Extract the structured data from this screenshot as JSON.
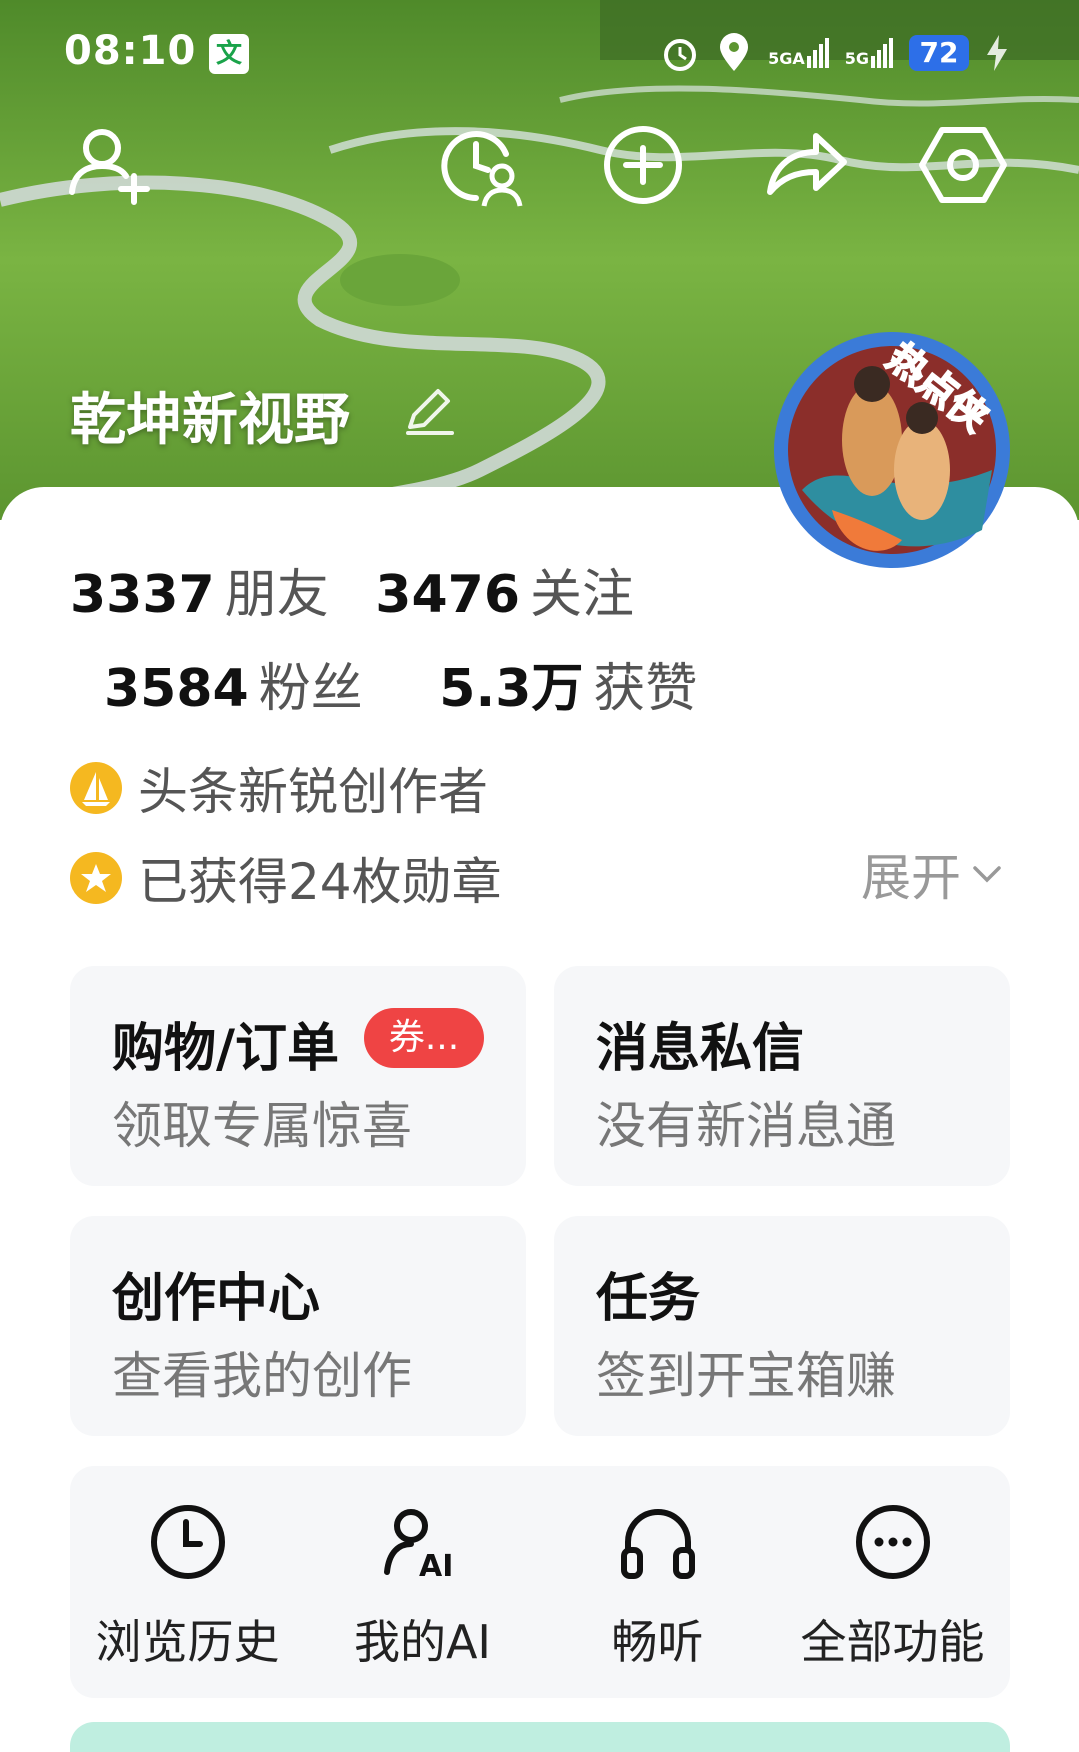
{
  "status_bar": {
    "time": "08:10",
    "app_badge": "文",
    "signal_1": "5GA",
    "signal_2": "5G",
    "battery": "72"
  },
  "profile": {
    "name": "乾坤新视野",
    "avatar_badge": "热点侠"
  },
  "stats": {
    "friends_value": "3337",
    "friends_label": "朋友",
    "following_value": "3476",
    "following_label": "关注",
    "fans_value": "3584",
    "fans_label": "粉丝",
    "likes_value": "5.3万",
    "likes_label": "获赞"
  },
  "meta": {
    "creator_level": "头条新锐创作者",
    "medals": "已获得24枚勋章",
    "expand_label": "展开"
  },
  "cards": [
    {
      "title": "购物/订单",
      "subtitle": "领取专属惊喜",
      "tag": "券..."
    },
    {
      "title": "消息私信",
      "subtitle": "没有新消息通"
    },
    {
      "title": "创作中心",
      "subtitle": "查看我的创作"
    },
    {
      "title": "任务",
      "subtitle": "签到开宝箱赚"
    }
  ],
  "quick_actions": [
    {
      "label": "浏览历史",
      "icon": "clock-icon"
    },
    {
      "label": "我的AI",
      "icon": "ai-person-icon"
    },
    {
      "label": "畅听",
      "icon": "headphones-icon"
    },
    {
      "label": "全部功能",
      "icon": "more-dots-icon"
    }
  ],
  "colors": {
    "accent_badge": "#f5b820",
    "tag_red": "#ef4444",
    "battery_blue": "#2d6fe8",
    "card_bg": "#f6f7f9"
  }
}
